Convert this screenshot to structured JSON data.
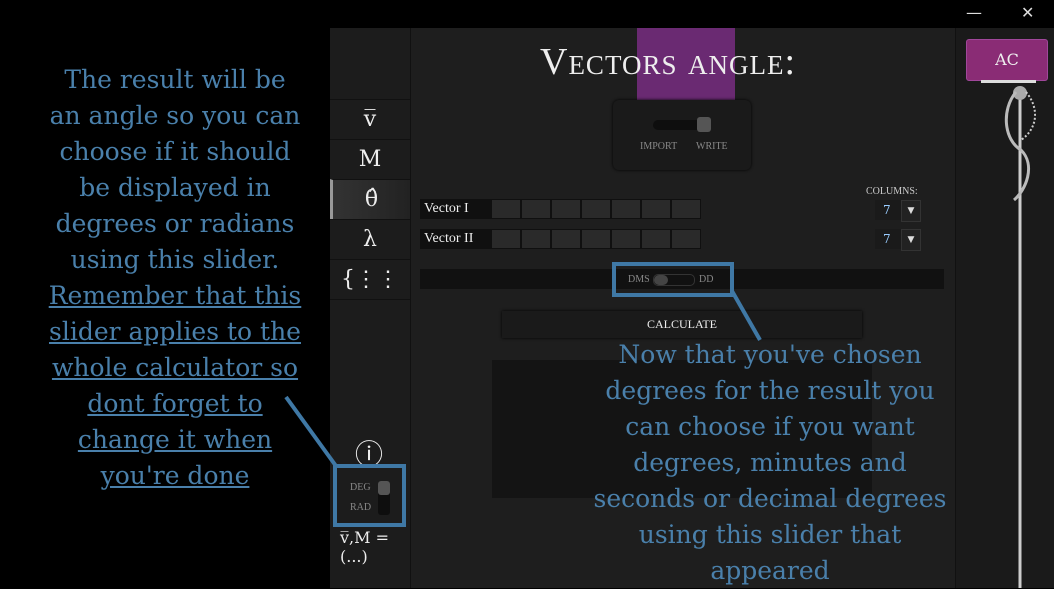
{
  "window": {
    "minimize": "—",
    "close": "✕"
  },
  "sidebar": {
    "items": [
      {
        "label": "v̅",
        "icon": "vector-icon"
      },
      {
        "label": "M",
        "icon": "matrix-icon"
      },
      {
        "label": "θ̂",
        "icon": "angle-icon",
        "active": true
      },
      {
        "label": "λ",
        "icon": "lambda-icon"
      },
      {
        "label": "{⋮⋮",
        "icon": "system-icon"
      }
    ],
    "info": "ⓘ",
    "deg": "DEG",
    "rad": "RAD",
    "angle_mode": "DEG",
    "footer": "v̅,M = (...)"
  },
  "main": {
    "title": "Vectors angle:",
    "import": "IMPORT",
    "write": "WRITE",
    "mode": "WRITE",
    "columns_label": "COLUMNS:",
    "rows": [
      {
        "label": "Vector  I",
        "columns": "7"
      },
      {
        "label": "Vector II",
        "columns": "7"
      }
    ],
    "dms": "DMS",
    "dd": "DD",
    "dms_mode": "DMS",
    "calculate": "CALCULATE"
  },
  "right": {
    "ac": "AC"
  },
  "annotations": {
    "left": [
      "The result will be",
      "an angle so you can",
      "choose if it should",
      "be displayed in",
      "degrees or radians",
      "using this slider."
    ],
    "left_underlined": [
      "Remember that this",
      "slider applies to the",
      "whole calculator so",
      "dont forget to",
      "change it when",
      "you're done"
    ],
    "right": [
      "Now that you've chosen",
      "degrees for the result you",
      "can choose if you want",
      "degrees, minutes and",
      "seconds or decimal degrees",
      "using this slider that",
      "appeared"
    ]
  },
  "colors": {
    "accent": "#8a2c75",
    "annotation": "#4a80ab"
  }
}
